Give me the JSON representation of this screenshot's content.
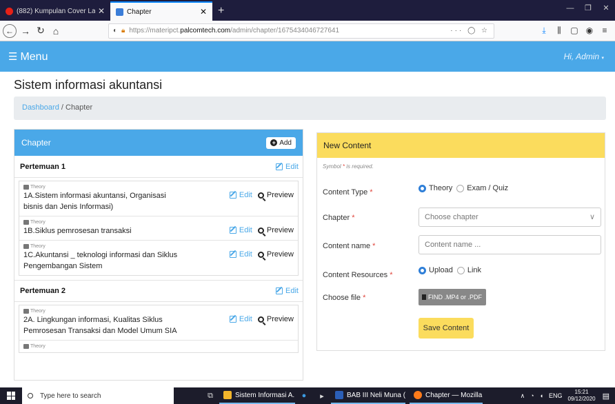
{
  "browser": {
    "tabs": [
      {
        "title": "(882) Kumpulan Cover Lagu Te",
        "active": false,
        "favicon": "youtube-icon"
      },
      {
        "title": "Chapter",
        "active": true,
        "favicon": "site-icon"
      }
    ],
    "new_tab": "+",
    "url_prefix": "https://materipct.",
    "url_domain": "palcomtech.com",
    "url_path": "/admin/chapter/1675434046727641",
    "url_more": "··· ◯ ☆"
  },
  "header": {
    "menu_label": "Menu",
    "user_greeting": "Hi, Admin"
  },
  "page": {
    "title": "Sistem informasi akuntansi",
    "breadcrumb": {
      "home": "Dashboard",
      "sep": " / ",
      "current": "Chapter"
    }
  },
  "chapter_panel": {
    "title": "Chapter",
    "add_label": "Add",
    "edit_label": "Edit",
    "preview_label": "Preview",
    "sections": [
      {
        "title": "Pertemuan 1",
        "items": [
          {
            "type": "Theory",
            "name": "1A.Sistem informasi akuntansi, Organisasi bisnis dan Jenis Informasi)"
          },
          {
            "type": "Theory",
            "name": "1B.Siklus pemrosesan transaksi"
          },
          {
            "type": "Theory",
            "name": "1C.Akuntansi _ teknologi informasi dan Siklus Pengembangan Sistem"
          }
        ]
      },
      {
        "title": "Pertemuan 2",
        "items": [
          {
            "type": "Theory",
            "name": "2A. Lingkungan informasi, Kualitas Siklus Pemrosesan Transaksi dan Model Umum SIA"
          },
          {
            "type": "Theory",
            "name": ""
          }
        ]
      }
    ]
  },
  "content_form": {
    "title": "New Content",
    "required_note": "Symbol",
    "required_star": "*",
    "required_suffix": "is required.",
    "content_type_label": "Content Type",
    "content_type_options": [
      "Theory",
      "Exam / Quiz"
    ],
    "chapter_label": "Chapter",
    "chapter_placeholder": "Choose chapter",
    "content_name_label": "Content name",
    "content_name_placeholder": "Content name ...",
    "resources_label": "Content Resources",
    "resources_options": [
      "Upload",
      "Link"
    ],
    "file_label": "Choose file",
    "file_button": "FIND .MP4 or .PDF",
    "save_label": "Save Content"
  },
  "taskbar": {
    "search_placeholder": "Type here to search",
    "apps": [
      {
        "label": "Sistem Informasi A...",
        "color": "#f2b52b"
      },
      {
        "label": "BAB III Neli Muna (...",
        "color": "#2b5fb8"
      },
      {
        "label": "Chapter — Mozilla ...",
        "color": "#ff7b1a"
      }
    ],
    "lang": "ENG",
    "time": "15:21",
    "date": "09/12/2020"
  },
  "colors": {
    "primary": "#4aa8e8",
    "warning": "#fbdc5d",
    "danger": "#e0443b"
  }
}
